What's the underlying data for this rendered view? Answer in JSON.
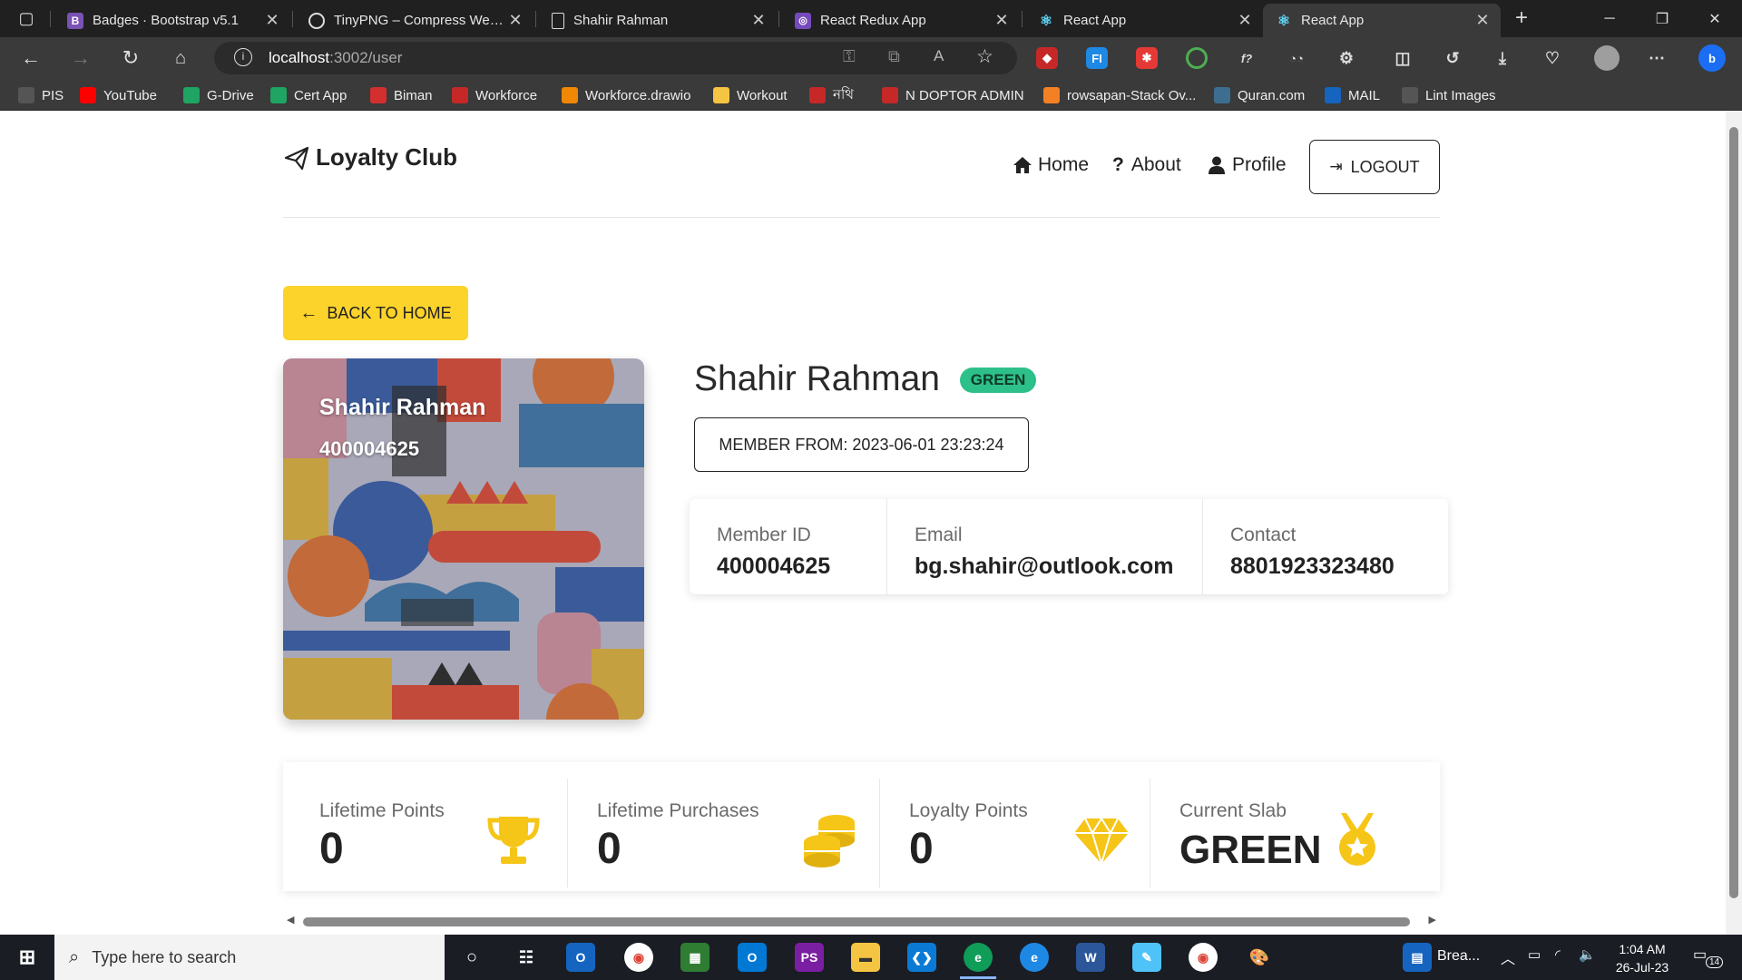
{
  "browser": {
    "tabs": [
      {
        "label": "Badges · Bootstrap v5.1",
        "icon": "bootstrap-icon",
        "color": "#7952b3"
      },
      {
        "label": "TinyPNG – Compress WebP",
        "icon": "tinypng-icon",
        "color": "#2a2a2a"
      },
      {
        "label": "Shahir Rahman",
        "icon": "document-icon",
        "color": "#2a2a2a"
      },
      {
        "label": "React Redux App",
        "icon": "redux-icon",
        "color": "#764abc"
      },
      {
        "label": "React App",
        "icon": "react-icon",
        "color": "#61dafb"
      },
      {
        "label": "React App",
        "icon": "react-icon",
        "color": "#61dafb"
      }
    ],
    "url_host": "localhost",
    "url_path": ":3002/user",
    "bookmarks": [
      {
        "label": "PIS",
        "icon": "page-icon",
        "color": "#555555"
      },
      {
        "label": "YouTube",
        "icon": "youtube-icon",
        "color": "#ff0000"
      },
      {
        "label": "G-Drive",
        "icon": "gdrive-icon",
        "color": "#1fa463"
      },
      {
        "label": "Cert App",
        "icon": "gdrive-icon",
        "color": "#1fa463"
      },
      {
        "label": "Biman",
        "icon": "biman-icon",
        "color": "#d32f2f"
      },
      {
        "label": "Workforce",
        "icon": "workforce-icon",
        "color": "#c62828"
      },
      {
        "label": "Workforce.drawio",
        "icon": "drawio-icon",
        "color": "#f08705"
      },
      {
        "label": "Workout",
        "icon": "folder-icon",
        "color": "#f4c542"
      },
      {
        "label": "নথি",
        "icon": "nothi-icon",
        "color": "#c62828"
      },
      {
        "label": "N DOPTOR ADMIN",
        "icon": "doptor-icon",
        "color": "#c62828"
      },
      {
        "label": "rowsapan-Stack Ov...",
        "icon": "stackoverflow-icon",
        "color": "#f48024"
      },
      {
        "label": "Quran.com",
        "icon": "quran-icon",
        "color": "#3c6e8f"
      },
      {
        "label": "MAIL",
        "icon": "mail-icon",
        "color": "#1565c0"
      },
      {
        "label": "Lint Images",
        "icon": "page-icon",
        "color": "#555555"
      }
    ]
  },
  "app": {
    "brand": "Loyalty Club",
    "nav": {
      "home": "Home",
      "about": "About",
      "profile": "Profile",
      "logout": "LOGOUT"
    },
    "back_button": "BACK TO HOME",
    "card": {
      "name": "Shahir Rahman",
      "number": "400004625"
    },
    "profile": {
      "name": "Shahir Rahman",
      "badge": "GREEN",
      "member_since": "MEMBER FROM: 2023-06-01 23:23:24"
    },
    "info": [
      {
        "label": "Member ID",
        "value": "400004625"
      },
      {
        "label": "Email",
        "value": "bg.shahir@outlook.com"
      },
      {
        "label": "Contact",
        "value": "8801923323480"
      }
    ],
    "stats": [
      {
        "label": "Lifetime Points",
        "value": "0",
        "icon": "trophy-icon"
      },
      {
        "label": "Lifetime Purchases",
        "value": "0",
        "icon": "coins-icon"
      },
      {
        "label": "Loyalty Points",
        "value": "0",
        "icon": "diamond-icon"
      },
      {
        "label": "Current Slab",
        "value": "GREEN",
        "icon": "medal-icon"
      }
    ],
    "colors": {
      "accent": "#fcd32b",
      "badge": "#2ec08a",
      "icon_gold": "#f5c518"
    }
  },
  "taskbar": {
    "search_placeholder": "Type here to search",
    "weather": "Brea...",
    "time": "1:04 AM",
    "date": "26-Jul-23",
    "notifications": "14"
  }
}
